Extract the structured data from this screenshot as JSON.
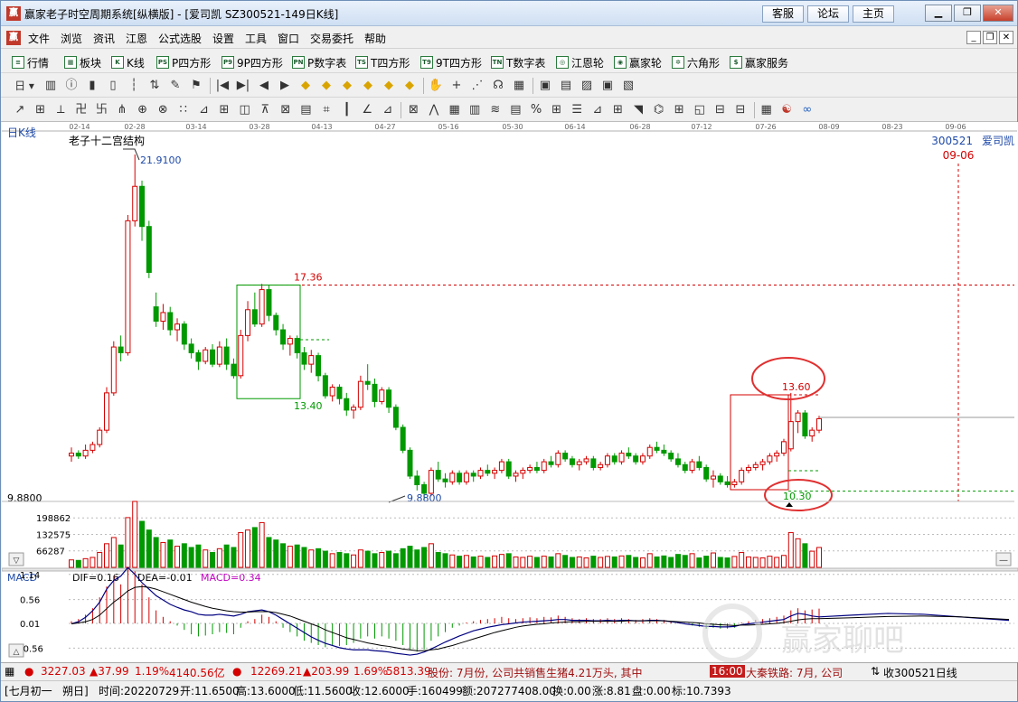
{
  "window": {
    "title": "赢家老子时空周期系统[纵横版] - [爱司凯  SZ300521-149日K线]",
    "app_icon": "赢",
    "links": [
      "客服",
      "论坛",
      "主页"
    ],
    "controls": [
      "minimize-icon",
      "restore-icon",
      "close-icon"
    ]
  },
  "menu": {
    "items": [
      "文件",
      "浏览",
      "资讯",
      "江恩",
      "公式选股",
      "设置",
      "工具",
      "窗口",
      "交易委托",
      "帮助"
    ]
  },
  "toolbar1": {
    "items": [
      {
        "label": "行情",
        "icon": "list-icon",
        "glyph": "≡"
      },
      {
        "label": "板块",
        "icon": "blocks-icon",
        "glyph": "▦"
      },
      {
        "label": "K线",
        "icon": "candles-icon",
        "glyph": "K"
      },
      {
        "label": "P四方形",
        "icon": "p-square-icon",
        "glyph": "PS"
      },
      {
        "label": "9P四方形",
        "icon": "9p-square-icon",
        "glyph": "P9"
      },
      {
        "label": "P数字表",
        "icon": "p-number-icon",
        "glyph": "PN"
      },
      {
        "label": "T四方形",
        "icon": "t-square-icon",
        "glyph": "TS"
      },
      {
        "label": "9T四方形",
        "icon": "9t-square-icon",
        "glyph": "T9"
      },
      {
        "label": "T数字表",
        "icon": "t-number-icon",
        "glyph": "TN"
      },
      {
        "label": "江恩轮",
        "icon": "gann-wheel-icon",
        "glyph": "◎"
      },
      {
        "label": "赢家轮",
        "icon": "winner-wheel-icon",
        "glyph": "◉"
      },
      {
        "label": "六角形",
        "icon": "hexagon-icon",
        "glyph": "✲"
      },
      {
        "label": "赢家服务",
        "icon": "dollar-icon",
        "glyph": "$"
      }
    ]
  },
  "toolbar2": {
    "period_label": "日",
    "icons": [
      "chart-icon",
      "info-icon",
      "bars-icon",
      "candle-icon",
      "bar-icon",
      "cursor-icon",
      "pencil-icon",
      "flag-icon",
      "first-icon",
      "last-icon",
      "left-icon",
      "right-icon",
      "diamond-1-icon",
      "diamond-2-icon",
      "diamond-3-icon",
      "diamond-4-icon",
      "diamond-5-icon",
      "diamond-6-icon",
      "hand-icon",
      "cross-icon",
      "lines-icon",
      "lasso-icon",
      "grid-icon",
      "calendar-icon",
      "calculator-icon",
      "save-icon",
      "print-icon",
      "printer-icon"
    ],
    "glyphs": [
      "▥",
      "ⓘ",
      "▮",
      "▯",
      "┆",
      "⇅",
      "✎",
      "⚑",
      "|◀",
      "▶|",
      "◀",
      "▶",
      "◆",
      "◆",
      "◆",
      "◆",
      "◆",
      "◆",
      "✋",
      "+",
      "⋰",
      "☊",
      "▦",
      "▣",
      "▤",
      "▨",
      "▣",
      "▧"
    ]
  },
  "toolbar3": {
    "icons": [
      "draw-1-icon",
      "draw-2-icon",
      "draw-3-icon",
      "draw-4-icon",
      "draw-5-icon",
      "draw-6-icon",
      "draw-7-icon",
      "draw-8-icon",
      "draw-9-icon",
      "draw-10-icon",
      "draw-11-icon",
      "draw-12-icon",
      "draw-13-icon",
      "draw-14-icon",
      "draw-15-icon",
      "draw-16-icon",
      "draw-17-icon",
      "draw-18-icon",
      "draw-19-icon",
      "draw-20-icon",
      "draw-21-icon",
      "draw-22-icon",
      "draw-23-icon",
      "draw-24-icon",
      "draw-25-icon",
      "percent-icon",
      "draw-27-icon",
      "draw-28-icon",
      "draw-29-icon",
      "draw-30-icon",
      "draw-31-icon",
      "draw-32-icon",
      "draw-33-icon",
      "draw-34-icon",
      "draw-35-icon",
      "draw-36-icon",
      "grid-icon",
      "yin-yang-icon",
      "infinity-icon"
    ],
    "glyphs": [
      "↗",
      "⊞",
      "⟂",
      "卍",
      "卐",
      "⋔",
      "⊕",
      "⊗",
      "∷",
      "⊿",
      "⊞",
      "◫",
      "⊼",
      "⊠",
      "▤",
      "⌗",
      "┃",
      "∠",
      "⊿",
      "⊠",
      "⋀",
      "▦",
      "▥",
      "≋",
      "▤",
      "%",
      "⊞",
      "☰",
      "⊿",
      "⊞",
      "◥",
      "⌬",
      "⊞",
      "◱",
      "⊟",
      "⊟",
      "▦",
      "☯",
      "∞"
    ]
  },
  "chart": {
    "indicator_label": "日K线",
    "structure_label": "老子十二宫结构",
    "stock_code": "300521",
    "stock_name": "爱司凯",
    "right_date": "09-06",
    "date_ticks": [
      "02-14",
      "02-28",
      "03-14",
      "03-28",
      "04-13",
      "04-27",
      "05-16",
      "05-30",
      "06-14",
      "06-28",
      "07-12",
      "07-26",
      "08-09",
      "08-23",
      "09-06"
    ],
    "price_labels": {
      "high": "21.9100",
      "box1_top": "17.36",
      "box1_bottom": "13.40",
      "low": "9.8800",
      "left_low": "9.8800",
      "box2_top": "13.60",
      "box2_bottom": "10.30"
    },
    "volume_ticks": [
      "198862",
      "132575",
      "66287"
    ],
    "macd": {
      "name": "MACD",
      "dif": "DIF=0.16",
      "dea": "DEA=-0.01",
      "macd": "MACD=0.34",
      "ticks": [
        "1.14",
        "0.56",
        "0.01",
        "-0.56"
      ]
    },
    "watermark": "赢家聊吧",
    "watermark_url": "liaoba.yjcf360.com",
    "colors": {
      "up": "#d40000",
      "down": "#009900",
      "annotation": "#d40000",
      "dif": "#000080",
      "dea": "#000000"
    }
  },
  "status": {
    "index1_value": "3227.03",
    "index1_change": "▲37.99",
    "index1_pct": "1.19%",
    "index1_amount": "4140.56亿",
    "index2_value": "12269.21",
    "index2_change": "▲203.99",
    "index2_pct": "1.69%",
    "index2_amount": "5813.39",
    "ticker": "股份: 7月份, 公司共销售生猪4.21万头, 其中",
    "time": "16:00",
    "ticker2": "大秦铁路: 7月, 公司",
    "right": "收300521日线"
  },
  "info": {
    "lunar": "[七月初一",
    "day": "朔日]",
    "time": "时间:20220729",
    "open": "开:11.6500",
    "high": "高:13.6000",
    "low": "低:11.5600",
    "close": "收:12.6000",
    "hand": "手:160499",
    "amount": "额:207277408.00",
    "turnover": "换:0.00",
    "change": "涨:8.81",
    "pan": "盘:0.00",
    "mark": "标:10.7393"
  }
}
